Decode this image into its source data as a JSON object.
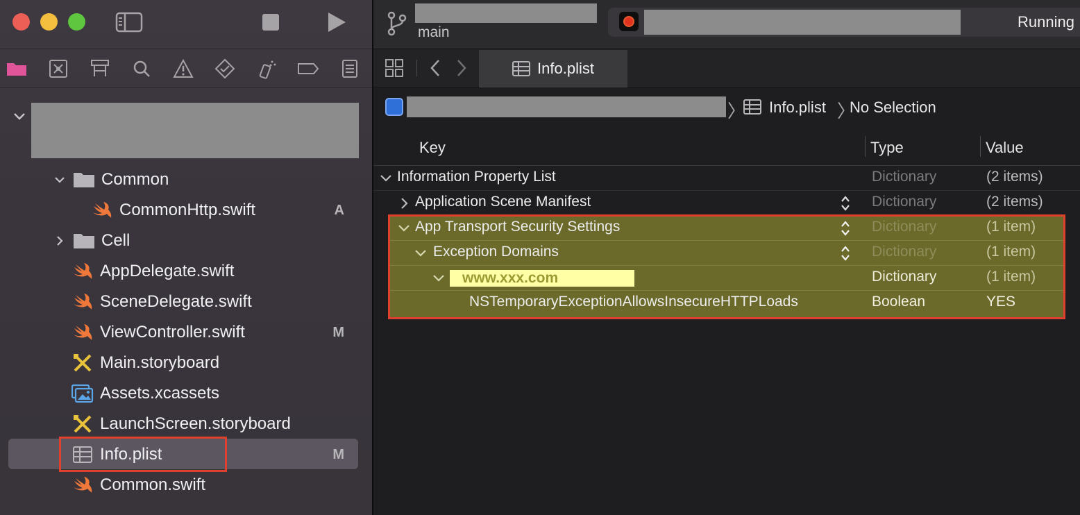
{
  "window": {
    "traffic_lights": [
      "close",
      "minimize",
      "zoom"
    ]
  },
  "toolbar": {
    "branch": "main",
    "run_status": "Running"
  },
  "navigator": {
    "tree": [
      {
        "label": "Common",
        "type": "folder",
        "expanded": true,
        "badge": ""
      },
      {
        "label": "CommonHttp.swift",
        "type": "swift",
        "badge": "A"
      },
      {
        "label": "Cell",
        "type": "folder",
        "expanded": false,
        "badge": ""
      },
      {
        "label": "AppDelegate.swift",
        "type": "swift",
        "badge": ""
      },
      {
        "label": "SceneDelegate.swift",
        "type": "swift",
        "badge": ""
      },
      {
        "label": "ViewController.swift",
        "type": "swift",
        "badge": "M"
      },
      {
        "label": "Main.storyboard",
        "type": "storyboard",
        "badge": ""
      },
      {
        "label": "Assets.xcassets",
        "type": "assets",
        "badge": ""
      },
      {
        "label": "LaunchScreen.storyboard",
        "type": "storyboard",
        "badge": ""
      },
      {
        "label": "Info.plist",
        "type": "plist",
        "badge": "M",
        "selected": true
      },
      {
        "label": "Common.swift",
        "type": "swift",
        "badge": ""
      }
    ]
  },
  "editor": {
    "tab_label": "Info.plist",
    "jump_bar": {
      "file": "Info.plist",
      "selection": "No Selection"
    },
    "columns": {
      "key": "Key",
      "type": "Type",
      "value": "Value"
    },
    "rows": [
      {
        "key": "Information Property List",
        "type": "Dictionary",
        "value": "(2 items)"
      },
      {
        "key": "Application Scene Manifest",
        "type": "Dictionary",
        "value": "(2 items)"
      },
      {
        "key": "App Transport Security Settings",
        "type": "Dictionary",
        "value": "(1 item)"
      },
      {
        "key": "Exception Domains",
        "type": "Dictionary",
        "value": "(1 item)"
      },
      {
        "key": "www.xxx.com",
        "type": "Dictionary",
        "value": "(1 item)"
      },
      {
        "key": "NSTemporaryExceptionAllowsInsecureHTTPLoads",
        "type": "Boolean",
        "value": "YES"
      }
    ]
  },
  "colors": {
    "highlight_bg": "#6b6a2a",
    "annotation_red": "#e0412e",
    "domain_highlight": "#ffffa6",
    "swift_orange": "#f0783a"
  }
}
